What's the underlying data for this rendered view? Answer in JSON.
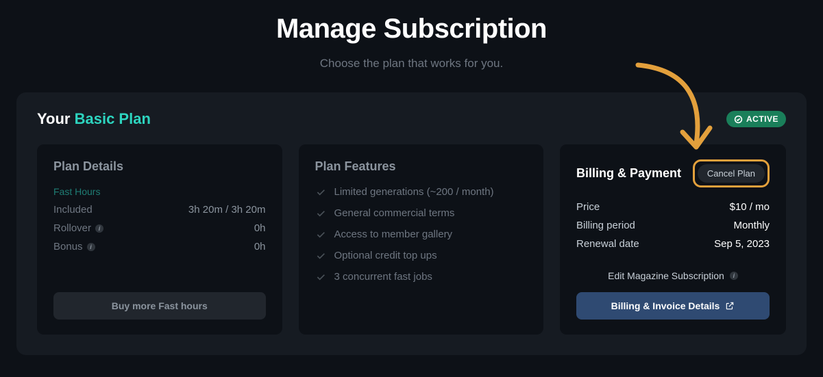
{
  "header": {
    "title": "Manage Subscription",
    "subtitle": "Choose the plan that works for you."
  },
  "plan": {
    "prefix": "Your",
    "name": "Basic Plan",
    "status": "ACTIVE"
  },
  "details": {
    "title": "Plan Details",
    "fast_hours_label": "Fast Hours",
    "rows": [
      {
        "k": "Included",
        "v": "3h 20m / 3h 20m"
      },
      {
        "k": "Rollover",
        "v": "0h",
        "info": true
      },
      {
        "k": "Bonus",
        "v": "0h",
        "info": true
      }
    ],
    "buy_more_label": "Buy more Fast hours"
  },
  "features": {
    "title": "Plan Features",
    "items": [
      "Limited generations (~200 / month)",
      "General commercial terms",
      "Access to member gallery",
      "Optional credit top ups",
      "3 concurrent fast jobs"
    ]
  },
  "billing": {
    "title": "Billing & Payment",
    "cancel_label": "Cancel Plan",
    "rows": [
      {
        "k": "Price",
        "v": "$10 / mo"
      },
      {
        "k": "Billing period",
        "v": "Monthly"
      },
      {
        "k": "Renewal date",
        "v": "Sep 5, 2023"
      }
    ],
    "edit_label": "Edit Magazine Subscription",
    "invoice_label": "Billing & Invoice Details"
  }
}
